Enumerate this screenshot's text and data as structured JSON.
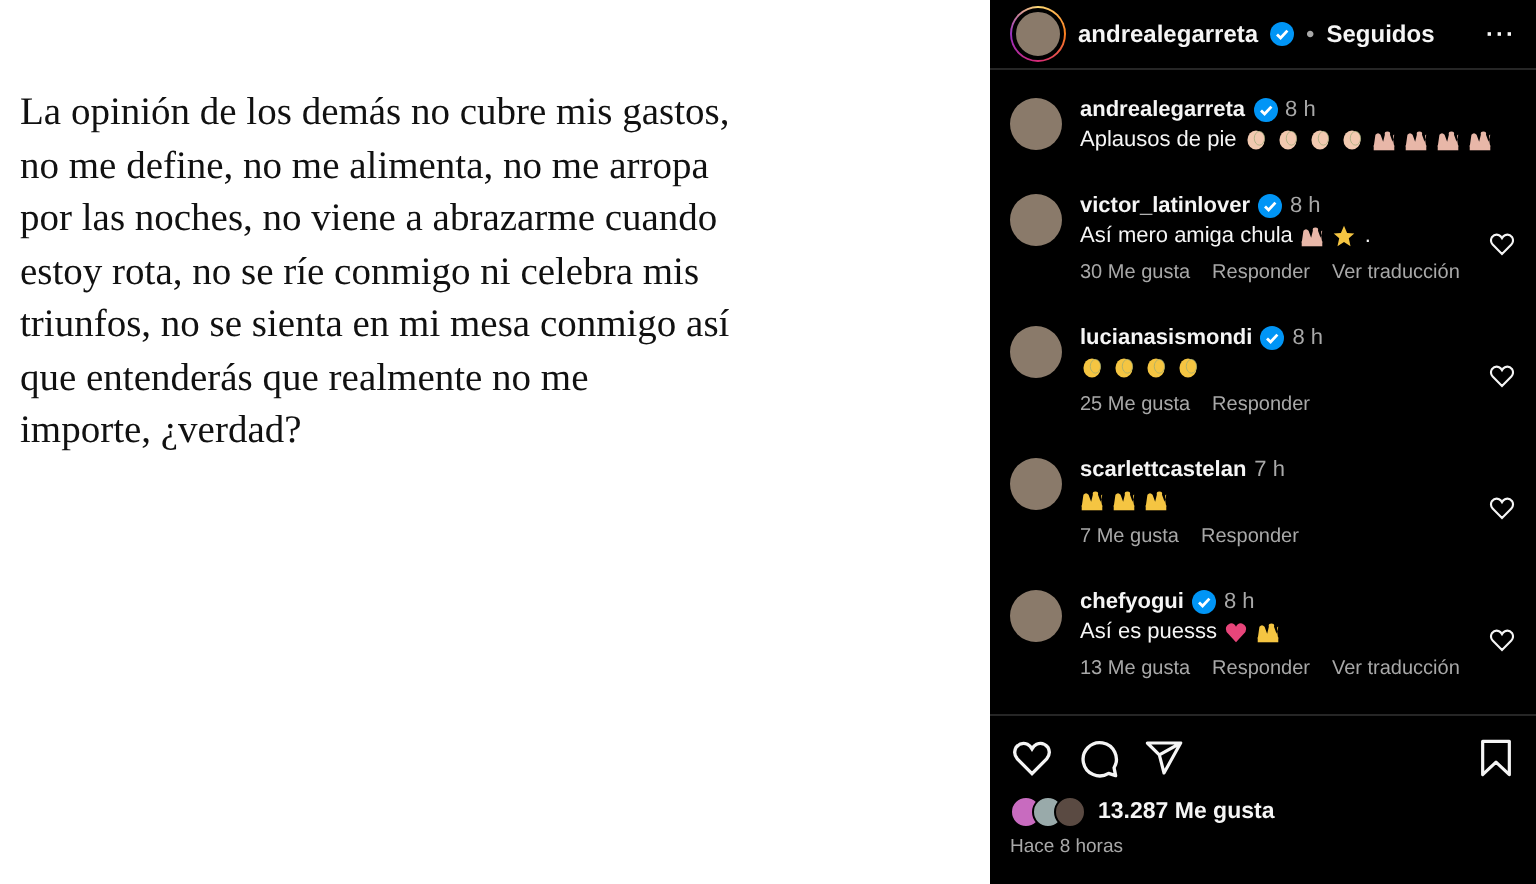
{
  "quote": {
    "text": "La opinión de los demás no cubre mis gastos,\nno me define, no me alimenta, no me arropa\npor las noches, no viene a abrazarme cuando\nestoy rota, no se ríe conmigo ni celebra mis\ntriunfos, no se sienta en mi mesa conmigo así\nque entenderás que realmente no me\nimporte, ¿verdad?"
  },
  "post_header": {
    "username": "andrealegarreta",
    "verified": true,
    "separator": "•",
    "follow_status": "Seguidos",
    "menu": "···"
  },
  "comments": [
    {
      "username": "andrealegarreta",
      "verified": true,
      "time": "8 h",
      "text": "Aplausos de pie",
      "emojis": [
        {
          "kind": "clap"
        },
        {
          "kind": "clap"
        },
        {
          "kind": "clap"
        },
        {
          "kind": "clap"
        },
        {
          "kind": "hands"
        },
        {
          "kind": "hands"
        },
        {
          "kind": "hands"
        },
        {
          "kind": "hands"
        }
      ]
    },
    {
      "username": "victor_latinlover",
      "verified": true,
      "time": "8 h",
      "text": "Así mero amiga chula",
      "emojis": [
        {
          "kind": "hands"
        },
        {
          "kind": "dizzy"
        }
      ],
      "tail": ".",
      "likes": "30 Me gusta",
      "actions": [
        "Responder",
        "Ver traducción"
      ]
    },
    {
      "username": "lucianasismondi",
      "verified": true,
      "time": "8 h",
      "emojis": [
        {
          "kind": "clap-yellow"
        },
        {
          "kind": "clap-yellow"
        },
        {
          "kind": "clap-yellow"
        },
        {
          "kind": "clap-yellow"
        }
      ],
      "likes": "25 Me gusta",
      "actions": [
        "Responder"
      ]
    },
    {
      "username": "scarlettcastelan",
      "verified": false,
      "time": "7 h",
      "emojis": [
        {
          "kind": "hands-yellow"
        },
        {
          "kind": "hands-yellow"
        },
        {
          "kind": "hands-yellow"
        }
      ],
      "likes": "7 Me gusta",
      "actions": [
        "Responder"
      ]
    },
    {
      "username": "chefyogui",
      "verified": true,
      "time": "8 h",
      "text": "Así es puesss",
      "emojis": [
        {
          "kind": "heart"
        },
        {
          "kind": "hands-yellow"
        }
      ],
      "likes": "13 Me gusta",
      "actions": [
        "Responder",
        "Ver traducción"
      ]
    }
  ],
  "likes_total": "13.287 Me gusta",
  "posted": "Hace 8 horas"
}
